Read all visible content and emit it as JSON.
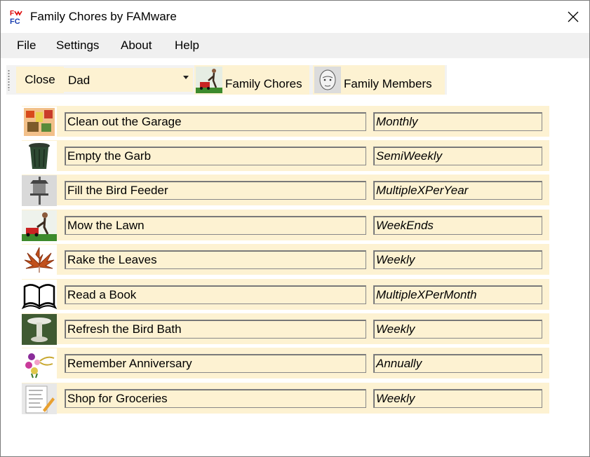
{
  "window": {
    "title": "Family Chores by FAMware",
    "app_icon": "fc-app-icon",
    "close_icon": "close-icon"
  },
  "menu": {
    "items": [
      {
        "label": "File"
      },
      {
        "label": "Settings"
      },
      {
        "label": "About"
      },
      {
        "label": "Help"
      }
    ]
  },
  "toolbar": {
    "close_label": "Close",
    "member_select": {
      "value": "Dad"
    },
    "family_chores_label": "Family Chores",
    "family_members_label": "Family Members"
  },
  "chores": [
    {
      "name": "Clean out the Garage",
      "frequency": "Monthly",
      "icon": "garage-icon"
    },
    {
      "name": "Empty the Garb",
      "frequency": "SemiWeekly",
      "icon": "garbage-can-icon"
    },
    {
      "name": "Fill the Bird Feeder",
      "frequency": "MultipleXPerYear",
      "icon": "bird-feeder-icon"
    },
    {
      "name": "Mow the Lawn",
      "frequency": "WeekEnds",
      "icon": "lawn-mower-icon"
    },
    {
      "name": "Rake the Leaves",
      "frequency": "Weekly",
      "icon": "leaf-icon"
    },
    {
      "name": "Read a Book",
      "frequency": "MultipleXPerMonth",
      "icon": "book-icon"
    },
    {
      "name": "Refresh the Bird Bath",
      "frequency": "Weekly",
      "icon": "bird-bath-icon"
    },
    {
      "name": "Remember Anniversary",
      "frequency": "Annually",
      "icon": "flowers-icon"
    },
    {
      "name": "Shop for Groceries",
      "frequency": "Weekly",
      "icon": "shopping-list-icon"
    }
  ]
}
